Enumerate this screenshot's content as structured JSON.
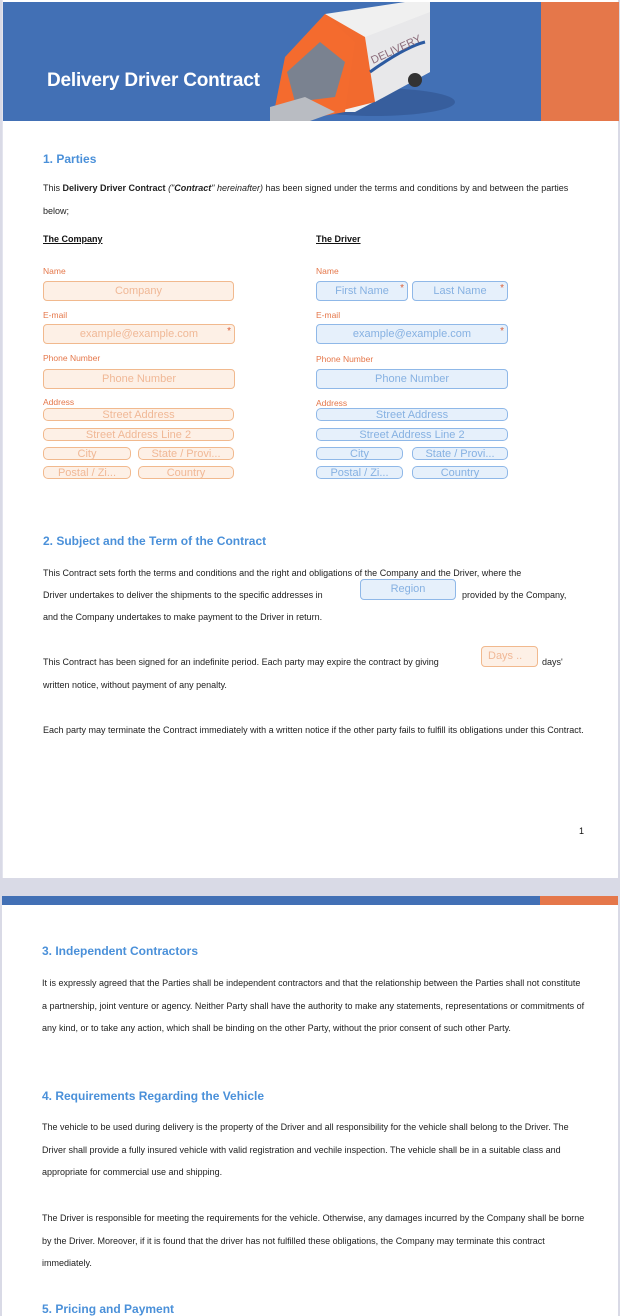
{
  "header": {
    "title": "Delivery Driver Contract",
    "van_text": "DELIVERY",
    "colors": {
      "primary": "#4270b5",
      "accent": "#e5774a",
      "heading": "#4a90d9"
    }
  },
  "sections": {
    "parties": {
      "title": "1. Parties",
      "intro_prefix": "This ",
      "intro_bold": "Delivery Driver Contract",
      "intro_quote_open": " (\"",
      "intro_quote_bold": "Contract",
      "intro_quote_rest": "\" hereinafter)",
      "intro_suffix": " has been signed under the terms and conditions by and between the parties below;",
      "company": {
        "heading": "The Company",
        "name_label": "Name",
        "name_placeholder": "Company",
        "email_label": "E-mail",
        "email_placeholder": "example@example.com",
        "phone_label": "Phone Number",
        "phone_placeholder": "Phone Number",
        "address_label": "Address",
        "street_placeholder": "Street Address",
        "street2_placeholder": "Street Address Line 2",
        "city_placeholder": "City",
        "state_placeholder": "State / Provi...",
        "postal_placeholder": "Postal / Zi...",
        "country_placeholder": "Country"
      },
      "driver": {
        "heading": "The Driver",
        "name_label": "Name",
        "first_name_placeholder": "First Name",
        "last_name_placeholder": "Last Name",
        "email_label": "E-mail",
        "email_placeholder": "example@example.com",
        "phone_label": "Phone Number",
        "phone_placeholder": "Phone Number",
        "address_label": "Address",
        "street_placeholder": "Street Address",
        "street2_placeholder": "Street Address Line 2",
        "city_placeholder": "City",
        "state_placeholder": "State / Provi...",
        "postal_placeholder": "Postal / Zi...",
        "country_placeholder": "Country"
      },
      "required_mark": "*"
    },
    "subject": {
      "title": "2. Subject and the Term of the Contract",
      "p1_line1": "This Contract sets forth the terms and conditions and the right and obligations of the Company and the Driver, where the",
      "p1_line2_before": "Driver undertakes to deliver the shipments to the specific addresses in",
      "region_placeholder": "Region",
      "p1_line2_after": "provided by the Company,",
      "p1_line3": "and the Company undertakes to make payment to the Driver in return.",
      "p2_before": "This Contract has been signed for an indefinite period. Each party may expire the contract by giving",
      "days_placeholder": "Days ..",
      "p2_after": "days'",
      "p2_line2": "written notice, without payment of any penalty.",
      "p3": "Each party may terminate the Contract immediately with a written notice if the other party fails to fulfill its obligations under this Contract."
    },
    "contractors": {
      "title": "3. Independent Contractors",
      "text": "It is expressly agreed that the Parties shall be independent contractors and that the relationship between the Parties shall not constitute a partnership, joint venture or agency. Neither Party shall have the authority to make any statements, representations or commitments of any kind, or to take any action, which shall be binding on the other Party, without the prior consent of such other Party."
    },
    "vehicle": {
      "title": "4. Requirements Regarding the Vehicle",
      "p1": "The vehicle to be used during delivery is the property of the Driver and all responsibility for the vehicle shall belong to the Driver. The Driver shall provide a fully insured vehicle with valid registration and vechile inspection. The vehicle shall be in a suitable class and appropriate for commercial use and shipping.",
      "p2": "The Driver is responsible for meeting the requirements for the vehicle. Otherwise, any damages incurred by the Company shall be borne by the Driver. Moreover, if it is found that the driver has not fulfilled these obligations, the Company may terminate this contract immediately."
    },
    "pricing": {
      "title": "5. Pricing and Payment"
    }
  },
  "page_number": "1"
}
